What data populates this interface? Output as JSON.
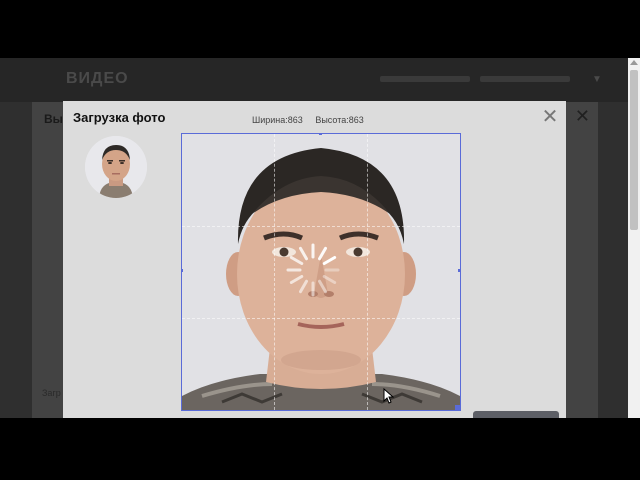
{
  "background_page": {
    "logo": "ВИДЕО",
    "dialog_title": "Выб",
    "dialog_close": "✕",
    "footer_text": "Загр"
  },
  "modal": {
    "title": "Загрузка фото",
    "width_label": "Ширина:863",
    "height_label": "Высота:863",
    "close_glyph": "✕"
  },
  "icons": {
    "close": "close-icon",
    "spinner": "loading-spinner-icon",
    "cursor": "mouse-cursor-icon"
  },
  "colors": {
    "crop_border": "#5a6bd8",
    "modal_bg": "#dcdcdc",
    "overlay": "#2f2f2f"
  }
}
